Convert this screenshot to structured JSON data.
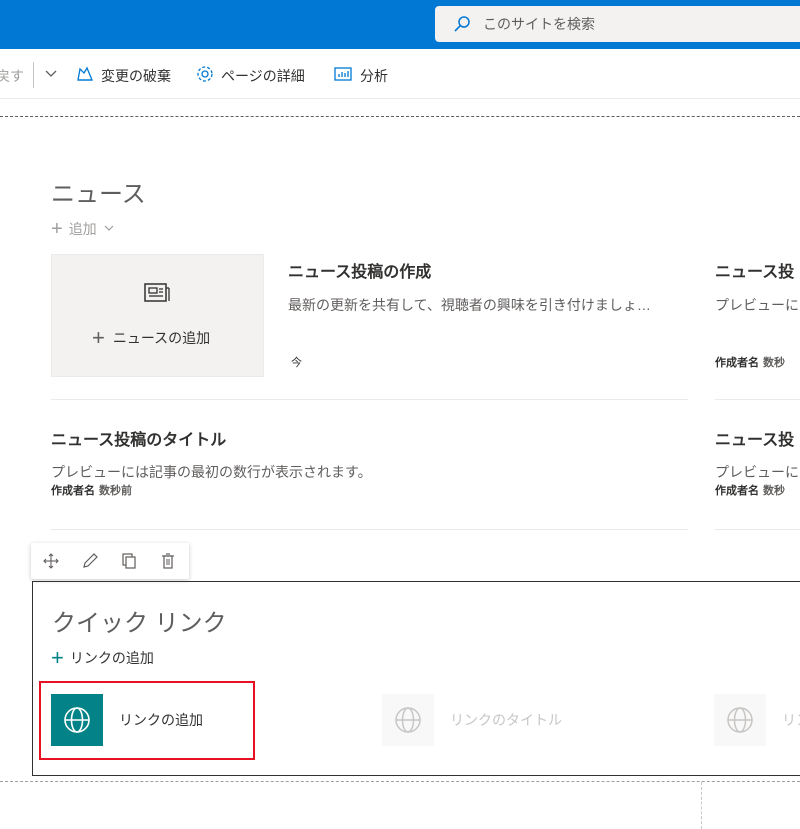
{
  "topbar": {
    "search_placeholder": "このサイトを検索"
  },
  "cmdbar": {
    "cut_label": "戻す",
    "discard_label": "変更の破棄",
    "page_details_label": "ページの詳細",
    "analytics_label": "分析"
  },
  "news": {
    "title": "ニュース",
    "add_label": "追加",
    "add_tile_label": "ニュースの追加",
    "create_post": {
      "title": "ニュース投稿の作成",
      "desc": "最新の更新を共有して、視聴者の興味を引き付けましょ…",
      "time": "今"
    },
    "right_post_1": {
      "title": "ニュース投",
      "desc": "プレビューに",
      "author": "作成者名",
      "age": "数秒"
    },
    "post": {
      "title": "ニュース投稿のタイトル",
      "desc": "プレビューには記事の最初の数行が表示されます。",
      "author": "作成者名",
      "age": "数秒前"
    },
    "right_post_2": {
      "title": "ニュース投",
      "desc": "プレビューに",
      "author": "作成者名",
      "age": "数秒"
    }
  },
  "quick_links": {
    "title": "クイック リンク",
    "add_label": "リンクの追加",
    "items": [
      {
        "label": "リンクの追加"
      },
      {
        "label": "リンクのタイトル"
      },
      {
        "label": "リン"
      }
    ]
  },
  "colors": {
    "suite_blue": "#0078d4",
    "teal": "#038387",
    "highlight_red": "#e81123"
  }
}
